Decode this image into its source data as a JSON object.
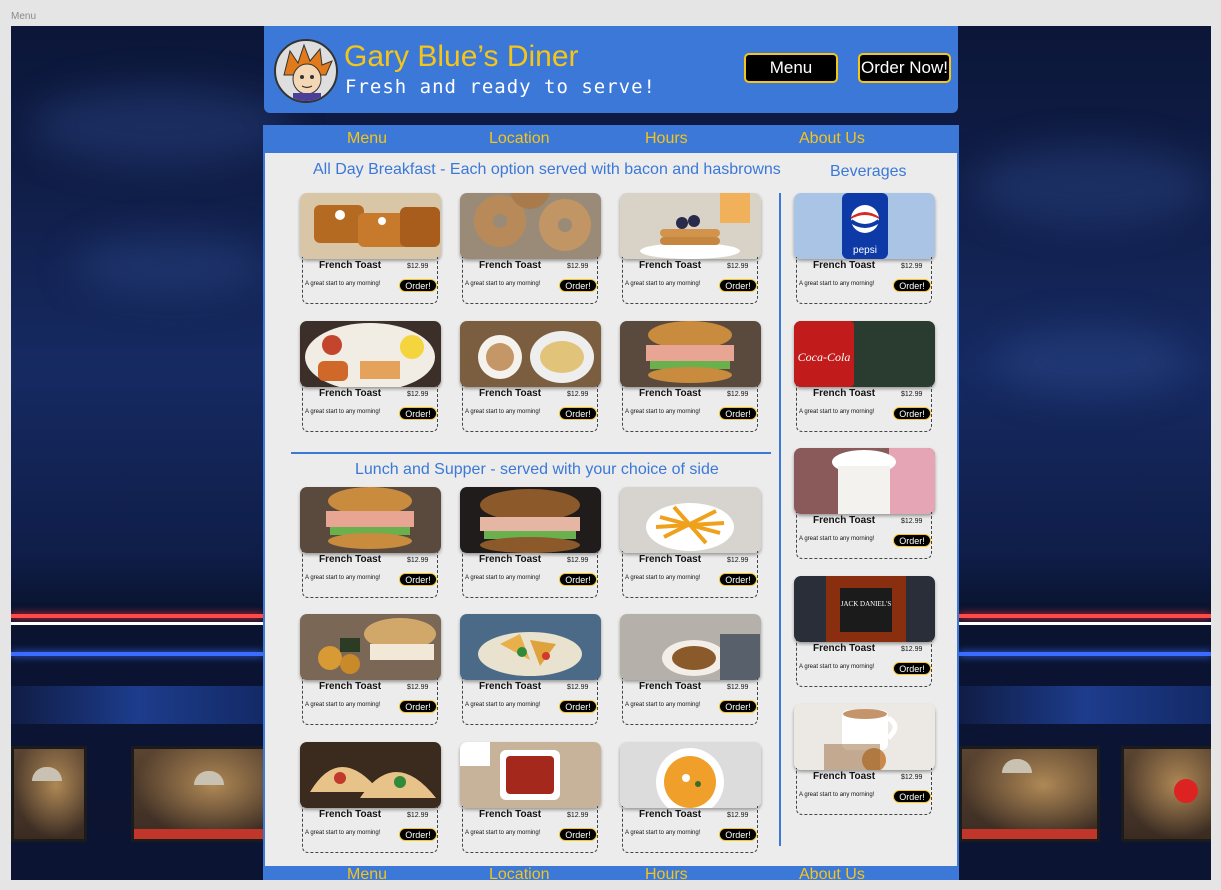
{
  "frame_label": "Menu",
  "header": {
    "title": "Gary Blue’s Diner",
    "tagline": "Fresh and ready to serve!",
    "menu_button": "Menu",
    "order_button": "Order Now!"
  },
  "nav": {
    "menu": "Menu",
    "location": "Location",
    "hours": "Hours",
    "about": "About Us"
  },
  "sections": {
    "breakfast": "All Day Breakfast - Each option served with bacon and hasbrowns",
    "lunch": "Lunch and Supper - served with your choice of side",
    "beverages": "Beverages"
  },
  "card": {
    "name": "French Toast",
    "price": "$12.99",
    "description": "A great start to any morning!",
    "order": "Order!"
  },
  "items": {
    "breakfast": [
      {
        "photo": "french-toast-photo"
      },
      {
        "photo": "bagels-photo"
      },
      {
        "photo": "pancakes-photo"
      },
      {
        "photo": "english-breakfast-photo"
      },
      {
        "photo": "omelette-coffee-photo"
      },
      {
        "photo": "pulled-pork-sandwich-photo"
      }
    ],
    "lunch": [
      {
        "photo": "burger-photo"
      },
      {
        "photo": "sandwich-photo"
      },
      {
        "photo": "fries-photo"
      },
      {
        "photo": "chicken-sandwich-photo"
      },
      {
        "photo": "nachos-photo"
      },
      {
        "photo": "street-food-photo"
      },
      {
        "photo": "tacos-photo"
      },
      {
        "photo": "chili-photo"
      },
      {
        "photo": "soup-photo"
      }
    ],
    "beverages": [
      {
        "photo": "pepsi-can-photo"
      },
      {
        "photo": "coca-cola-can-photo"
      },
      {
        "photo": "milkshake-photo"
      },
      {
        "photo": "whiskey-bottle-photo"
      },
      {
        "photo": "coffee-cookies-photo"
      }
    ]
  },
  "photo_texts": {
    "pepsi": "pepsi",
    "cola": "Coca-Cola",
    "whiskey": "JACK DANIEL'S"
  },
  "colors": {
    "brand_blue": "#3b78d8",
    "accent_yellow": "#f5c518",
    "button_black": "#000000"
  }
}
